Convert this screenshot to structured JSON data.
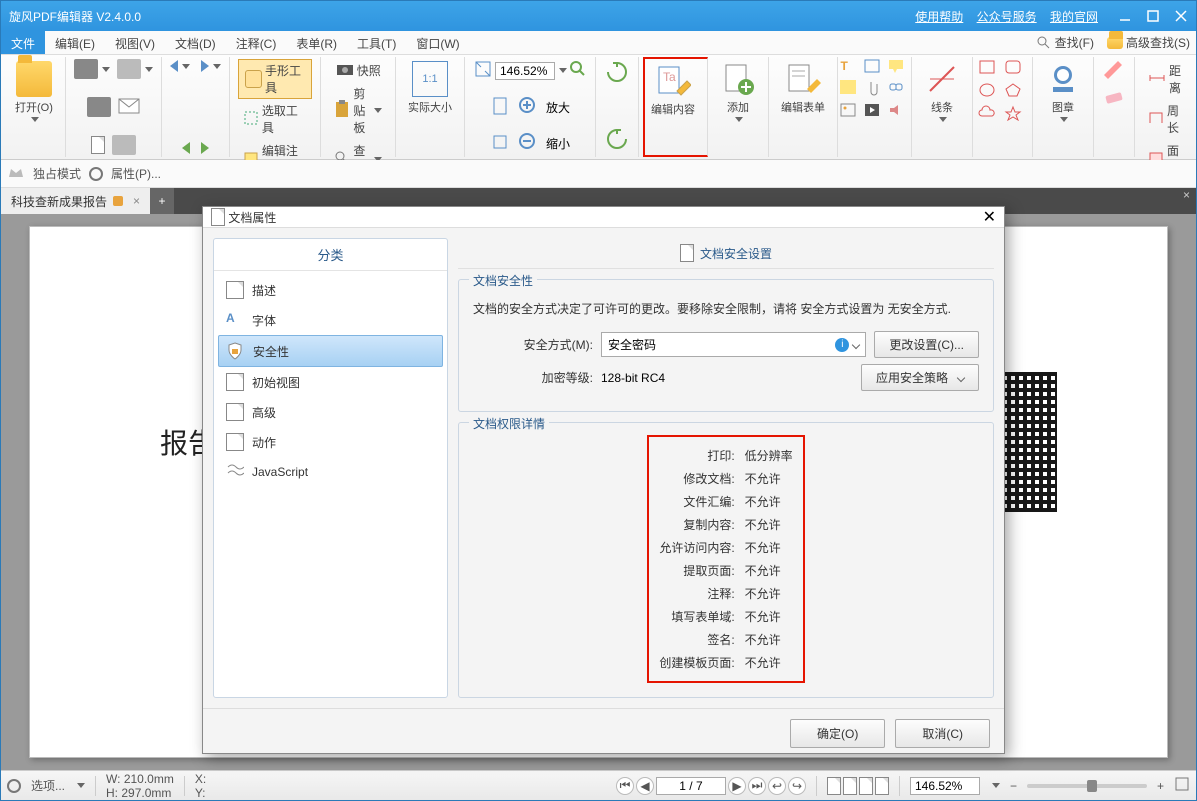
{
  "title": "旋风PDF编辑器 V2.4.0.0",
  "titlelinks": {
    "help": "使用帮助",
    "service": "公众号服务",
    "site": "我的官网"
  },
  "menu": {
    "file": "文件",
    "edit": "编辑(E)",
    "view": "视图(V)",
    "doc": "文档(D)",
    "annot": "注释(C)",
    "form": "表单(R)",
    "tool": "工具(T)",
    "window": "窗口(W)",
    "find_r": "查找(F)",
    "advfind_r": "高级查找(S)"
  },
  "ribbon": {
    "open": "打开(O)",
    "snapshot": "快照",
    "clipboard": "剪贴板",
    "actual": "实际大小",
    "find": "查找",
    "zoomin": "放大",
    "zoomout": "缩小",
    "zoom_val": "146.52%",
    "hand": "手形工具",
    "select": "选取工具",
    "annot_tool": "编辑注释工具",
    "edit_content": "编辑内容",
    "add": "添加",
    "edit_form": "编辑表单",
    "lines": "线条",
    "stamp": "图章",
    "distance": "距离",
    "perimeter": "周长",
    "area": "面积"
  },
  "secondbar": {
    "exclusive": "独占模式",
    "props": "属性(P)..."
  },
  "tab": {
    "name": "科技查新成果报告"
  },
  "doc": {
    "sample_text": "报告"
  },
  "status": {
    "options": "选项...",
    "w_label": "W:",
    "w": "210.0mm",
    "h_label": "H:",
    "h": "297.0mm",
    "x_label": "X:",
    "y_label": "Y:",
    "page": "1 / 7",
    "zoom": "146.52%"
  },
  "dialog": {
    "title": "文档属性",
    "cat_header": "分类",
    "main_header": "文档安全设置",
    "cats": {
      "desc": "描述",
      "font": "字体",
      "security": "安全性",
      "initview": "初始视图",
      "adv": "高级",
      "action": "动作",
      "js": "JavaScript"
    },
    "sec1": {
      "legend": "文档安全性",
      "desc": "文档的安全方式决定了可许可的更改。要移除安全限制，请将 安全方式设置为 无安全方式.",
      "method_label": "安全方式(M):",
      "method_val": "安全密码",
      "change_btn": "更改设置(C)...",
      "enc_label": "加密等级:",
      "enc_val": "128-bit RC4",
      "policy_btn": "应用安全策略"
    },
    "sec2": {
      "legend": "文档权限详情",
      "perms": [
        {
          "k": "打印:",
          "v": "低分辨率"
        },
        {
          "k": "修改文档:",
          "v": "不允许"
        },
        {
          "k": "文件汇编:",
          "v": "不允许"
        },
        {
          "k": "复制内容:",
          "v": "不允许"
        },
        {
          "k": "允许访问内容:",
          "v": "不允许"
        },
        {
          "k": "提取页面:",
          "v": "不允许"
        },
        {
          "k": "注释:",
          "v": "不允许"
        },
        {
          "k": "填写表单域:",
          "v": "不允许"
        },
        {
          "k": "签名:",
          "v": "不允许"
        },
        {
          "k": "创建模板页面:",
          "v": "不允许"
        }
      ]
    },
    "ok": "确定(O)",
    "cancel": "取消(C)"
  }
}
